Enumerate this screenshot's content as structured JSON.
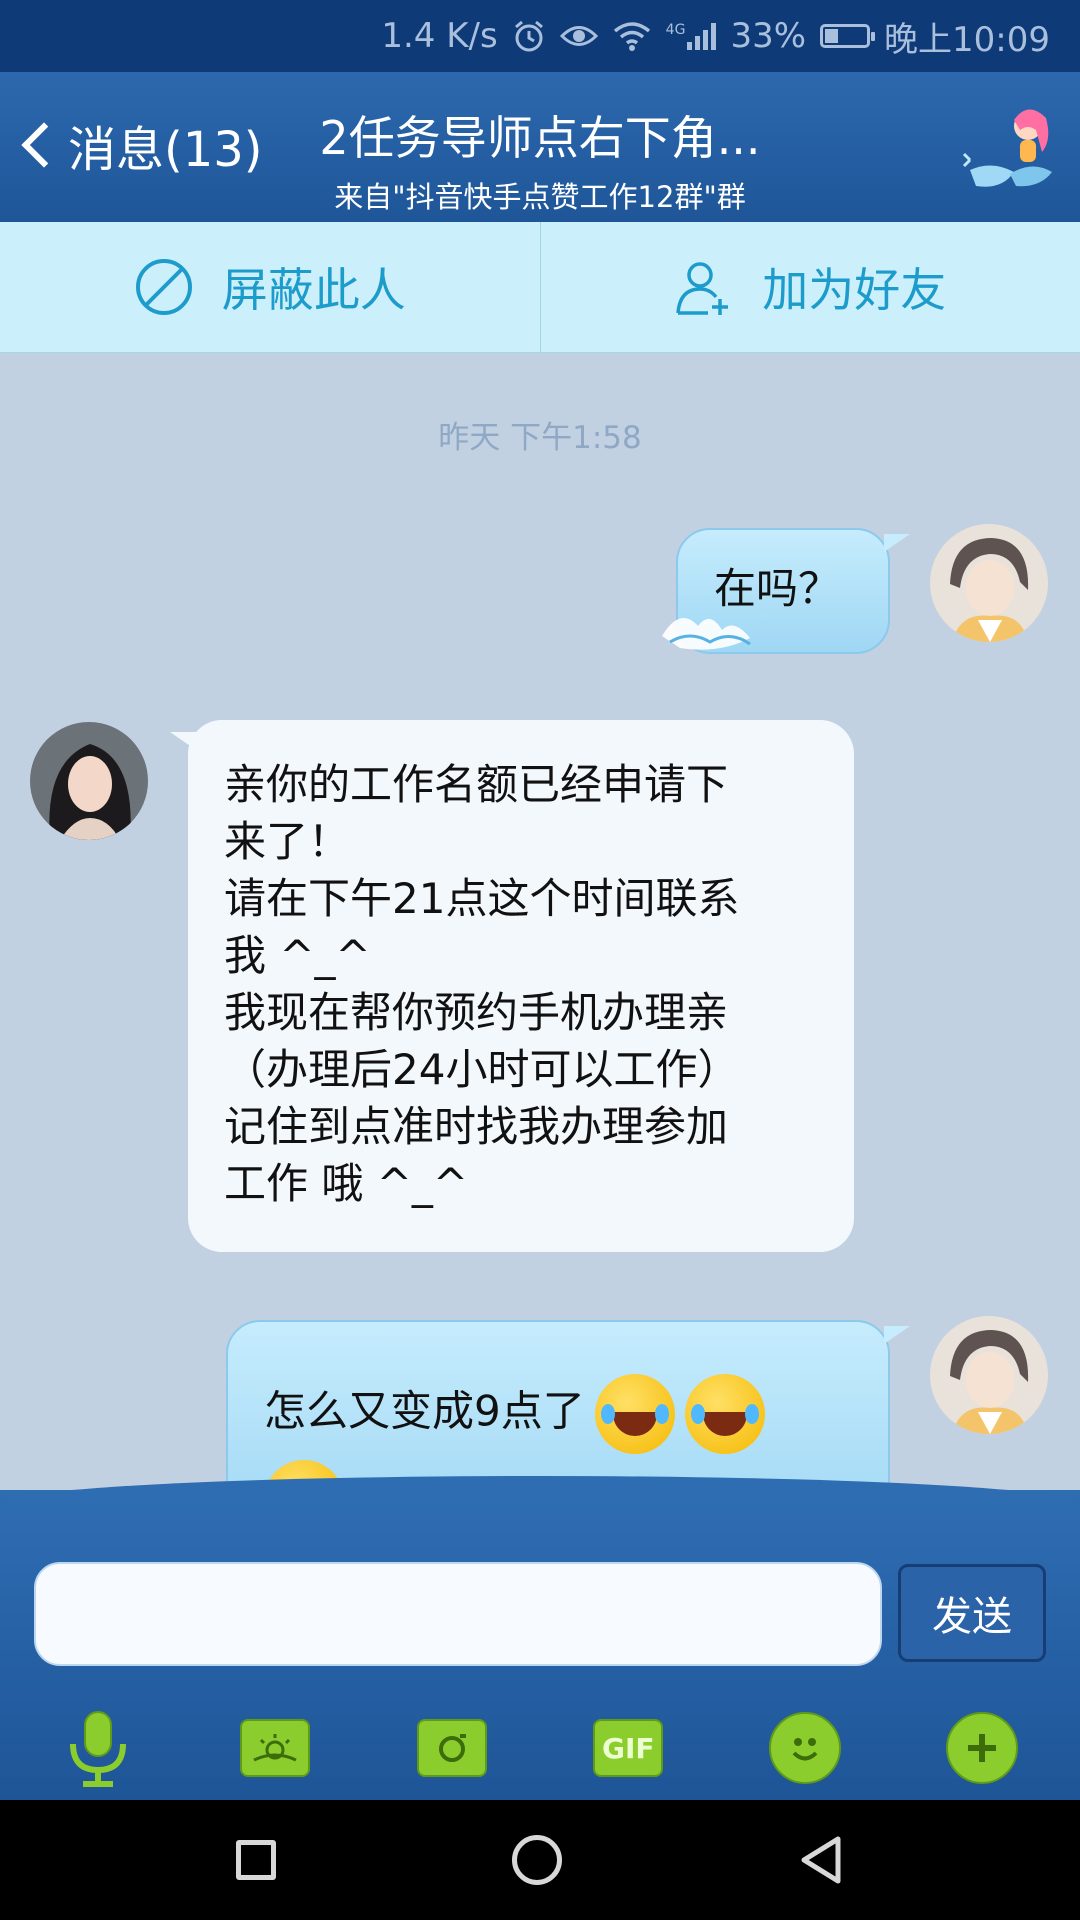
{
  "status_bar": {
    "speed": "1.4 K/s",
    "network": "4G",
    "battery": "33%",
    "battery_level": 0.33,
    "time": "晚上10:09",
    "icons": [
      "alarm-icon",
      "eye-icon",
      "wifi-icon",
      "signal-icon",
      "battery-icon"
    ]
  },
  "header": {
    "back_label": "消息(13)",
    "title": "2任务导师点右下角...",
    "subtitle": "来自\"抖音快手点赞工作12群\"群",
    "decor_icon": "mermaid-icon"
  },
  "actions": {
    "block_label": "屏蔽此人",
    "add_friend_label": "加为好友"
  },
  "chat": {
    "timestamp": "昨天 下午1:58",
    "messages": [
      {
        "side": "right",
        "lines": [
          "在吗？"
        ]
      },
      {
        "side": "left",
        "lines": [
          "亲你的工作名额已经申请下",
          "来了！",
          "请在下午21点这个时间联系",
          "我  ^_^",
          "我现在帮你预约手机办理亲",
          "（办理后24小时可以工作）",
          "记住到点准时找我办理参加",
          "工作 哦 ^_^"
        ]
      },
      {
        "side": "right",
        "lines": [
          "怎么又变成9点了"
        ],
        "emoji": [
          "laughing-tears-emoji",
          "laughing-tears-emoji",
          "laughing-tears-emoji"
        ]
      }
    ]
  },
  "input": {
    "value": "",
    "send_label": "发送"
  },
  "toolbar": {
    "gif_label": "GIF",
    "items": [
      "microphone-icon",
      "image-icon",
      "camera-icon",
      "gif-icon",
      "emoji-icon",
      "plus-icon"
    ],
    "accent": "#8ccd2e"
  },
  "colors": {
    "header": "#1e5698",
    "action_bar": "#ccf0fb",
    "action_text": "#1d9ccc",
    "chat_bg": "#c2d1e2"
  }
}
